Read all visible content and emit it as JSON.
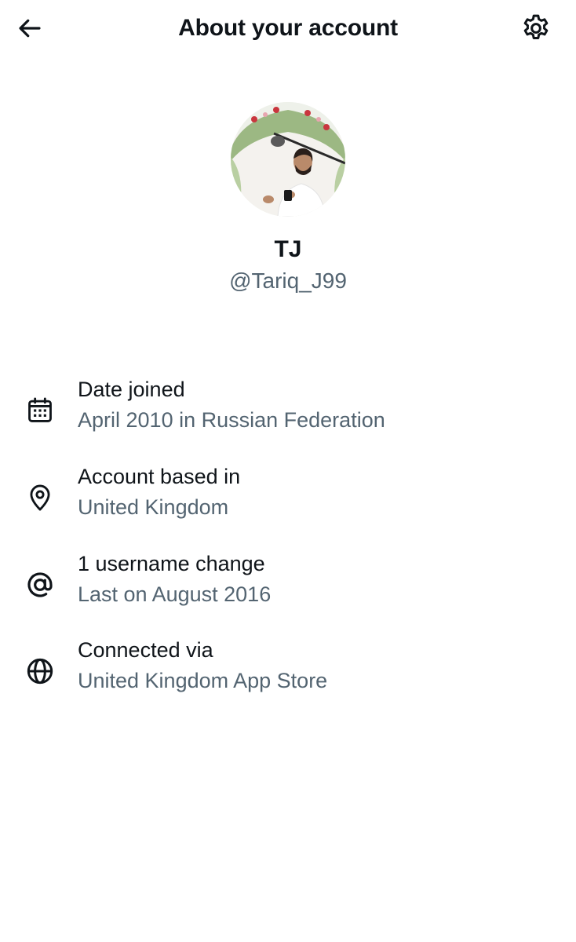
{
  "header": {
    "title": "About your account",
    "back_icon": "arrow-left-icon",
    "settings_icon": "gear-icon"
  },
  "profile": {
    "display_name": "TJ",
    "handle": "@Tariq_J99",
    "avatar": "profile-photo"
  },
  "details": [
    {
      "icon": "calendar-icon",
      "label": "Date joined",
      "value": "April 2010 in Russian Federation"
    },
    {
      "icon": "location-pin-icon",
      "label": "Account based in",
      "value": "United Kingdom"
    },
    {
      "icon": "at-sign-icon",
      "label": "1 username change",
      "value": "Last on August 2016"
    },
    {
      "icon": "globe-icon",
      "label": "Connected via",
      "value": "United Kingdom App Store"
    }
  ],
  "colors": {
    "text_primary": "#0f1419",
    "text_secondary": "#536471",
    "background": "#ffffff"
  }
}
